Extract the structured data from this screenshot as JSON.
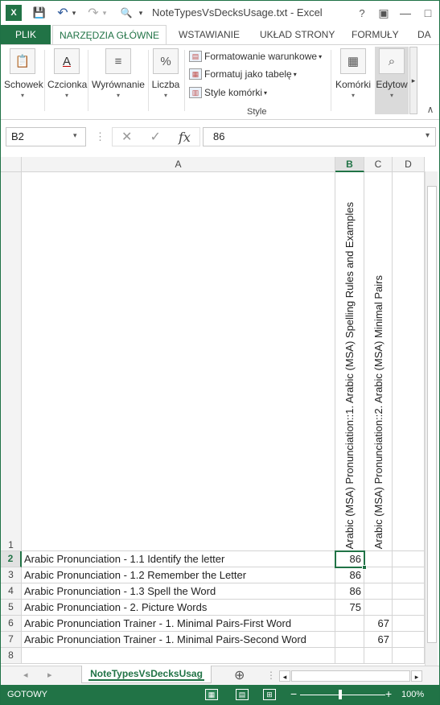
{
  "window": {
    "title": "NoteTypesVsDecksUsage.txt - Excel",
    "app_icon": "excel-icon",
    "min_glyph": "—",
    "max_glyph": "□",
    "close_glyph": "✕",
    "help_glyph": "?",
    "restore_glyph": "▣"
  },
  "quick_access": {
    "save_glyph": "💾",
    "undo_glyph": "↶",
    "redo_glyph": "↷",
    "preview_glyph": "🔍",
    "custom_glyph": "⋯"
  },
  "tabs": [
    "PLIK",
    "NARZĘDZIA GŁÓWNE",
    "WSTAWIANIE",
    "UKŁAD STRONY",
    "FORMUŁY",
    "DA"
  ],
  "ribbon": {
    "groups": [
      {
        "label": "Schowek",
        "glyph": "📋"
      },
      {
        "label": "Czcionka",
        "glyph": "A"
      },
      {
        "label": "Wyrównanie",
        "glyph": "≡"
      },
      {
        "label": "Liczba",
        "glyph": "%"
      },
      {
        "label": "Komórki",
        "glyph": "▦"
      },
      {
        "label": "Edytow",
        "glyph": "⌕"
      }
    ],
    "style_items": [
      "Formatowanie warunkowe",
      "Formatuj jako tabelę",
      "Style komórki"
    ],
    "style_group_label": "Style",
    "dropdown_glyph": "▾",
    "collapse_glyph": "∧",
    "scroll_right_glyph": "▸"
  },
  "formula_bar": {
    "name_box": "B2",
    "cancel_glyph": "✕",
    "enter_glyph": "✓",
    "fx_glyph": "fx",
    "value": "86",
    "more_glyph": "⋮"
  },
  "columns": [
    "A",
    "B",
    "C",
    "D"
  ],
  "header_row": {
    "row": "1",
    "b": "Arabic (MSA) Pronunciation::1. Arabic (MSA) Spelling Rules and Examples",
    "c": "Arabic (MSA) Pronunciation::2. Arabic (MSA) Minimal Pairs"
  },
  "rows": [
    {
      "row": "2",
      "a": "Arabic Pronunciation - 1.1 Identify the letter",
      "b": "86",
      "c": ""
    },
    {
      "row": "3",
      "a": "Arabic Pronunciation - 1.2 Remember the Letter",
      "b": "86",
      "c": ""
    },
    {
      "row": "4",
      "a": "Arabic Pronunciation - 1.3 Spell the Word",
      "b": "86",
      "c": ""
    },
    {
      "row": "5",
      "a": "Arabic Pronunciation - 2. Picture Words",
      "b": "75",
      "c": ""
    },
    {
      "row": "6",
      "a": "Arabic Pronunciation Trainer - 1. Minimal Pairs-First Word",
      "b": "",
      "c": "67"
    },
    {
      "row": "7",
      "a": "Arabic Pronunciation Trainer - 1. Minimal Pairs-Second Word",
      "b": "",
      "c": "67"
    },
    {
      "row": "8",
      "a": "",
      "b": "",
      "c": ""
    }
  ],
  "selected": {
    "column": "B",
    "row": "2"
  },
  "sheet_tab": "NoteTypesVsDecksUsag",
  "sheet_nav": {
    "prev": "◂",
    "next": "▸",
    "add": "⊕",
    "more": "⋮"
  },
  "status": {
    "ready": "GOTOWY",
    "zoom": "100%",
    "zoom_level": 100,
    "minus": "−",
    "plus": "+",
    "view_normal_glyph": "▦",
    "view_layout_glyph": "▤",
    "view_break_glyph": "⊞"
  }
}
